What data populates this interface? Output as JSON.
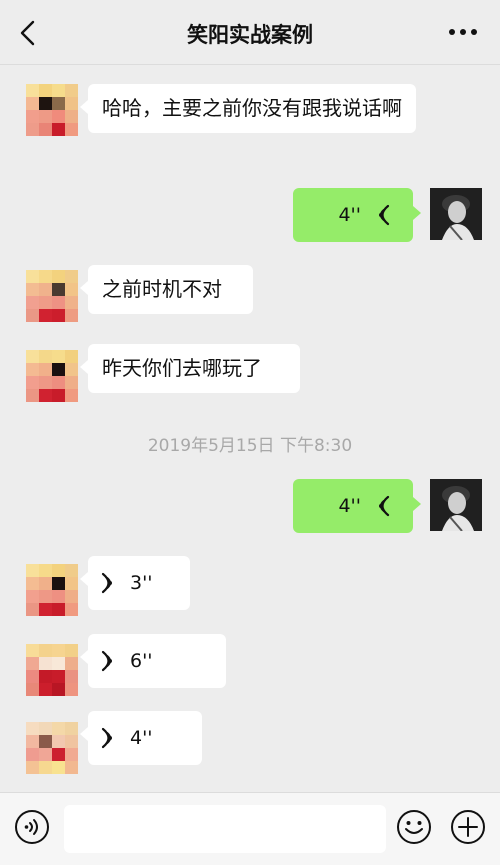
{
  "header": {
    "title": "笑阳实战案例",
    "back_icon": "chevron-left-icon",
    "more_icon": "more-dots-icon"
  },
  "messages": [
    {
      "side": "received",
      "type": "text",
      "text": "哈哈，主要之前你没有跟我说话啊"
    },
    {
      "side": "sent",
      "type": "voice",
      "duration": "4''"
    },
    {
      "side": "received",
      "type": "text",
      "text": "之前时机不对"
    },
    {
      "side": "received",
      "type": "text",
      "text": "昨天你们去哪玩了"
    },
    {
      "side": "sent",
      "type": "voice",
      "duration": "4''"
    },
    {
      "side": "received",
      "type": "voice",
      "duration": "3''"
    },
    {
      "side": "received",
      "type": "voice",
      "duration": "6''"
    },
    {
      "side": "received",
      "type": "voice",
      "duration": "4''"
    }
  ],
  "timestamp": "2019年5月15日 下午8:30",
  "input_bar": {
    "voice_icon": "voice-mode-icon",
    "text_value": "",
    "emoji_icon": "emoji-icon",
    "plus_icon": "plus-icon"
  },
  "colors": {
    "background": "#ededed",
    "sent_bubble": "#95ec69",
    "received_bubble": "#ffffff",
    "timestamp_text": "#a8a8a8"
  }
}
